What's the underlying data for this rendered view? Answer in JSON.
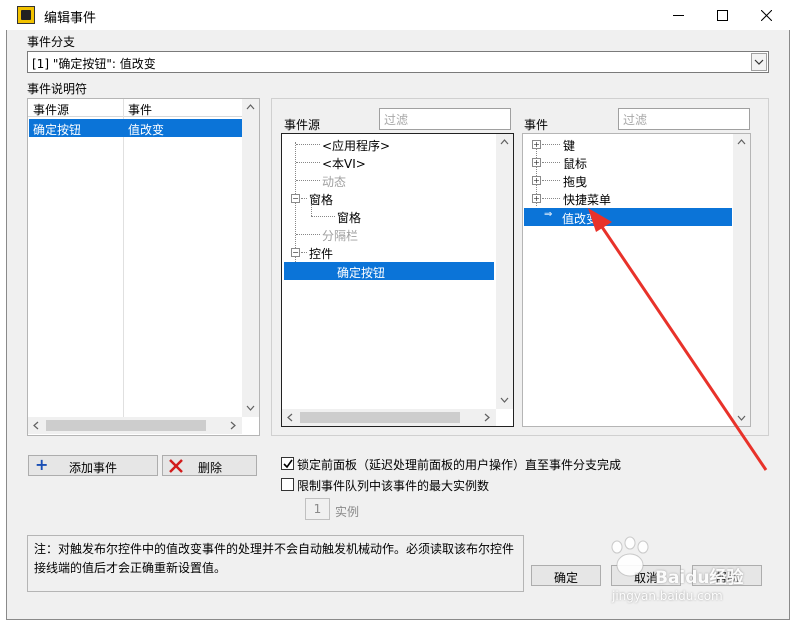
{
  "window": {
    "title": "编辑事件"
  },
  "branch": {
    "label": "事件分支",
    "value": "[1] \"确定按钮\": 值改变"
  },
  "specifiers": {
    "label": "事件说明符",
    "columns": [
      "事件源",
      "事件"
    ],
    "rows": [
      {
        "source": "确定按钮",
        "event": "值改变"
      }
    ]
  },
  "event_source": {
    "label": "事件源",
    "filter_placeholder": "过滤",
    "items": [
      "<应用程序>",
      "<本VI>",
      "动态",
      "窗格",
      "窗格",
      "分隔栏",
      "控件",
      "确定按钮"
    ]
  },
  "events": {
    "label": "事件",
    "filter_placeholder": "过滤",
    "items": [
      "键",
      "鼠标",
      "拖曳",
      "快捷菜单",
      "值改变"
    ]
  },
  "buttons": {
    "add_event": "添加事件",
    "delete": "删除",
    "ok": "确定",
    "cancel": "取消",
    "help": "帮助"
  },
  "options": {
    "lock_panel": {
      "label": "锁定前面板（延迟处理前面板的用户操作）直至事件分支完成",
      "checked": true
    },
    "limit_queue": {
      "label": "限制事件队列中该事件的最大实例数",
      "checked": false
    },
    "instances_value": "1",
    "instances_label": "实例"
  },
  "note": {
    "text": "注：对触发布尔控件中的值改变事件的处理并不会自动触发机械动作。必须读取该布尔控件接线端的值后才会正确重新设置值。"
  },
  "watermark": {
    "brand": "Baidu经验",
    "url": "jingyan.baidu.com"
  },
  "colors": {
    "selection": "#0b74d8",
    "annotation_arrow": "#e8322a"
  }
}
